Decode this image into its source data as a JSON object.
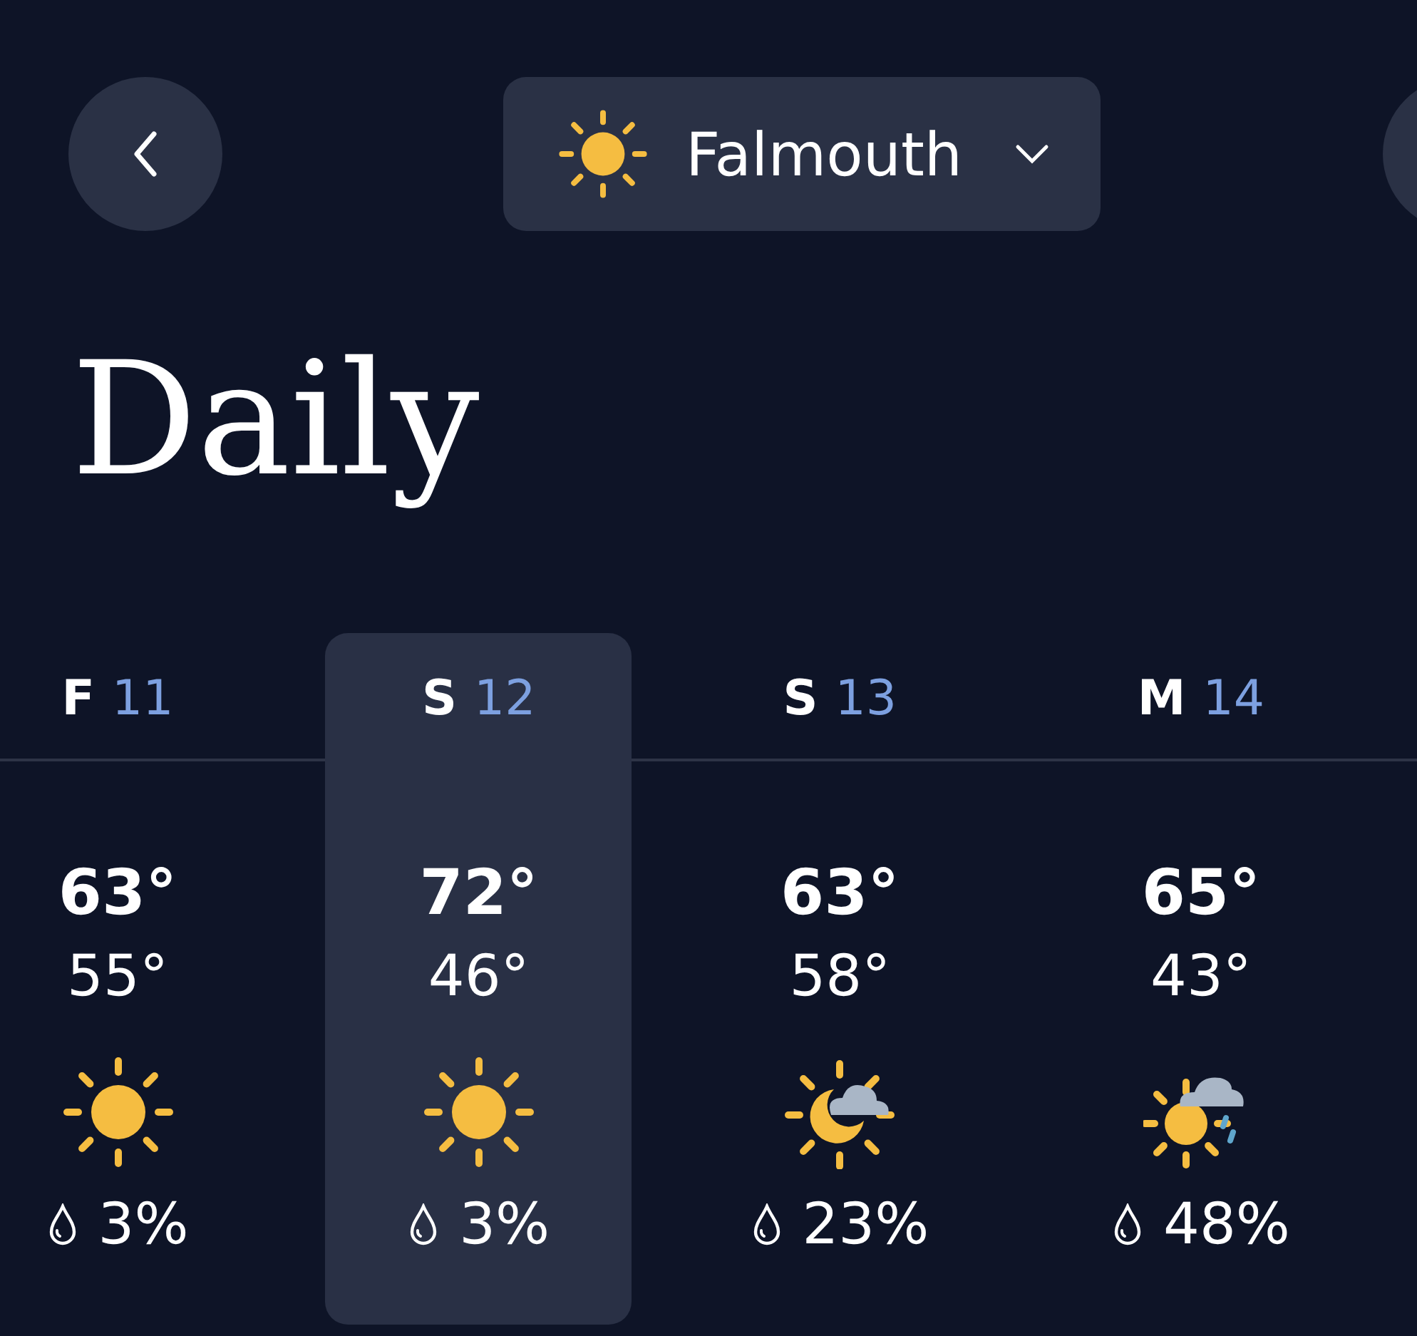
{
  "header": {
    "location": "Falmouth"
  },
  "title": "Daily",
  "days": [
    {
      "weekday": "F",
      "date": "11",
      "high": "63°",
      "low": "55°",
      "kind": "sun",
      "precip": "3%",
      "selected": false
    },
    {
      "weekday": "S",
      "date": "12",
      "high": "72°",
      "low": "46°",
      "kind": "sun",
      "precip": "3%",
      "selected": true
    },
    {
      "weekday": "S",
      "date": "13",
      "high": "63°",
      "low": "58°",
      "kind": "moon-cloud",
      "precip": "23%",
      "selected": false
    },
    {
      "weekday": "M",
      "date": "14",
      "high": "65°",
      "low": "43°",
      "kind": "sun-cloud-rain",
      "precip": "48%",
      "selected": false
    }
  ]
}
